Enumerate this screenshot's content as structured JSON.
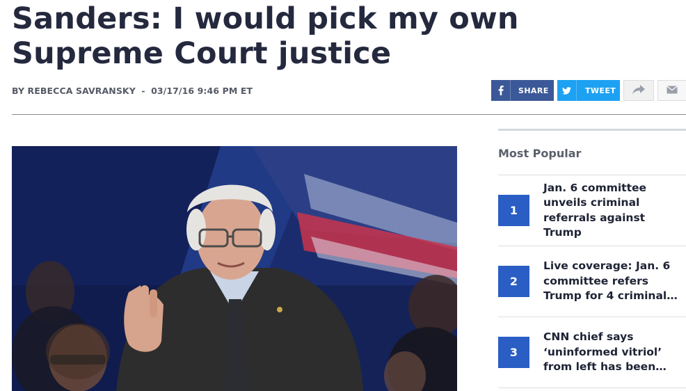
{
  "article": {
    "headline": "Sanders: I would pick my own Supreme Court justice",
    "author": "BY REBECCA SAVRANSKY",
    "separator": "-",
    "timestamp": "03/17/16 9:46 PM ET",
    "photo_icon": "photo-of-speaker-at-town-hall"
  },
  "share": {
    "facebook_label": "SHARE",
    "twitter_label": "TWEET",
    "facebook_icon": "facebook-icon",
    "twitter_icon": "twitter-icon",
    "more_icon": "share-arrow-icon",
    "email_icon": "email-icon",
    "facebook_color": "#3b5998",
    "twitter_color": "#1da1f2"
  },
  "sidebar": {
    "title": "Most Popular",
    "accent": "#2a5ec4",
    "items": [
      {
        "num": "1",
        "text": "Jan. 6 committee\nunveils criminal\nreferrals against Trump"
      },
      {
        "num": "2",
        "text": "Live coverage: Jan. 6\ncommittee refers\nTrump for 4 criminal…"
      },
      {
        "num": "3",
        "text": "CNN chief says\n‘uninformed vitriol’\nfrom left has been…"
      }
    ]
  }
}
